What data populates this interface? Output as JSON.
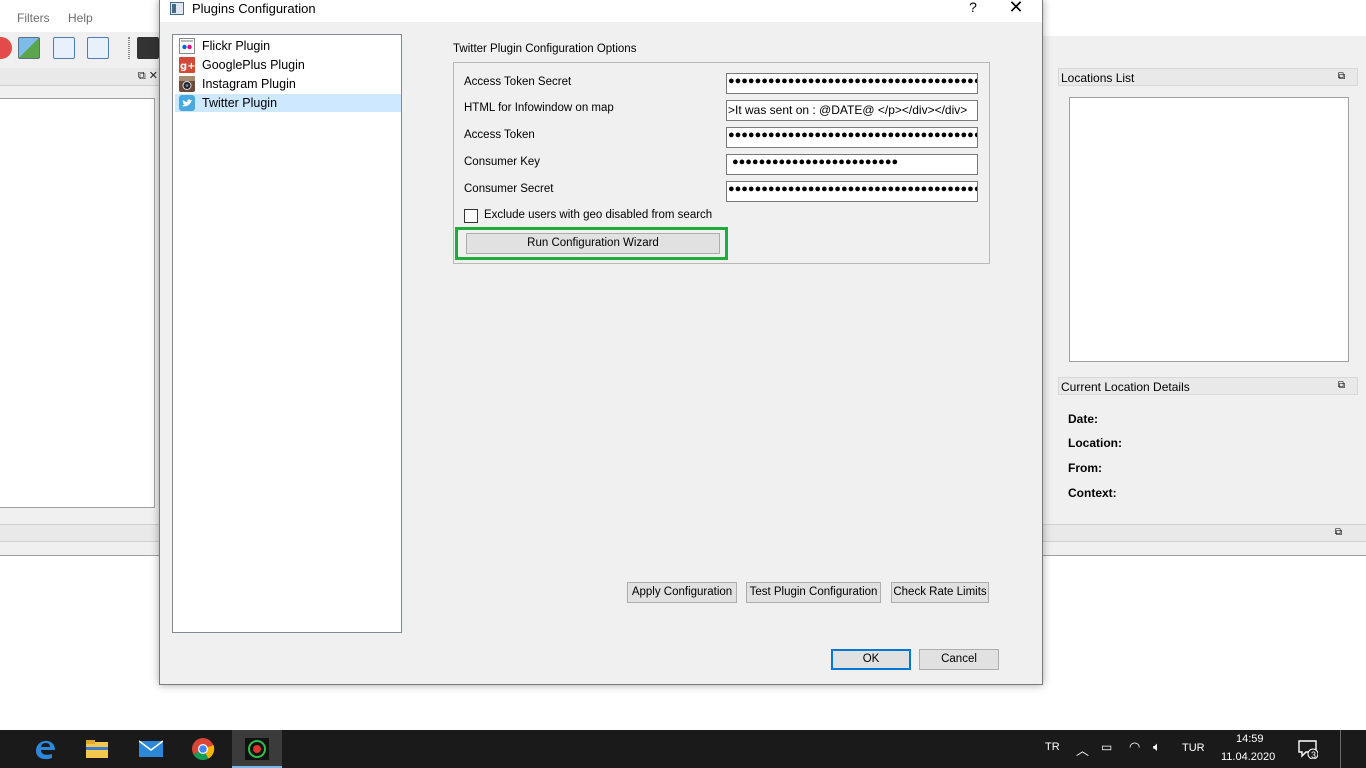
{
  "main_window": {
    "menu": [
      "Filters",
      "Help"
    ],
    "locations_list_title": "Locations List",
    "current_location_title": "Current Location Details",
    "details": [
      "Date:",
      "Location:",
      "From:",
      "Context:"
    ]
  },
  "dialog": {
    "title": "Plugins Configuration",
    "help_label": "?",
    "close_label": "✕",
    "plugins": [
      {
        "label": "Flickr Plugin",
        "icon": "flickr-icon"
      },
      {
        "label": "GooglePlus Plugin",
        "icon": "googleplus-icon"
      },
      {
        "label": "Instagram Plugin",
        "icon": "instagram-icon"
      },
      {
        "label": "Twitter Plugin",
        "icon": "twitter-icon"
      }
    ],
    "selected_plugin": "Twitter Plugin",
    "group_title": "Twitter Plugin Configuration Options",
    "fields": [
      {
        "label": "Access Token Secret",
        "value": "●●●●●●●●●●●●●●●●●●●●●●●●●●●●●●●●●●●●●●●●●●●●●●●●●●"
      },
      {
        "label": "HTML for Infowindow on map",
        "value": ">It was sent on : @DATE@ </p></div></div>"
      },
      {
        "label": "Access Token",
        "value": "●●●●●●●●●●●●●●●●●●●●●●●●●●●●●●●●●●●●●●●●●●●●●●●●●●"
      },
      {
        "label": "Consumer Key",
        "value": "●●●●●●●●●●●●●●●●●●●●●●●●●"
      },
      {
        "label": "Consumer Secret",
        "value": "●●●●●●●●●●●●●●●●●●●●●●●●●●●●●●●●●●●●●●●●●●●●●●●●●●"
      }
    ],
    "exclude_checkbox": {
      "label": "Exclude users with geo disabled from search",
      "checked": false
    },
    "wizard_button": "Run Configuration Wizard",
    "apply_button": "Apply Configuration",
    "test_button": "Test Plugin Configuration",
    "rate_button": "Check Rate Limits",
    "ok_button": "OK",
    "cancel_button": "Cancel",
    "highlight_color": "#1fac3a"
  },
  "taskbar": {
    "lang_short": "TR",
    "lang": "TUR",
    "time": "14:59",
    "date": "11.04.2020",
    "notification_count": "3"
  }
}
